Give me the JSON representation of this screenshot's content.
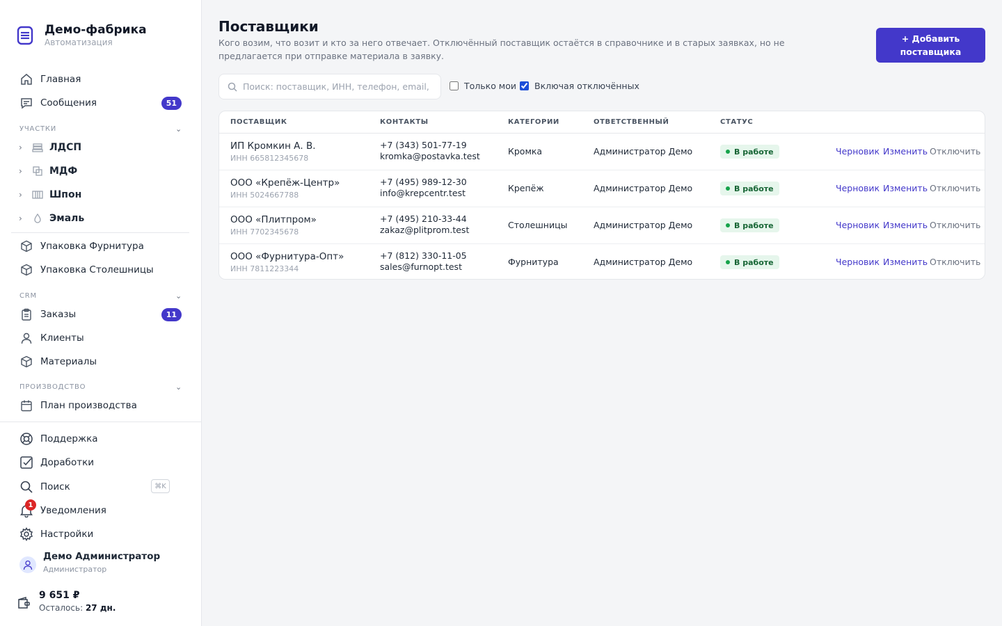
{
  "brand": {
    "name": "Демо-фабрика",
    "subtitle": "Автоматизация"
  },
  "nav": {
    "home": "Главная",
    "messages": {
      "label": "Сообщения",
      "badge": "51"
    },
    "sections": {
      "sites": "Участки",
      "crm": "CRM",
      "production": "Производство"
    },
    "sites": [
      {
        "label": "ЛДСП"
      },
      {
        "label": "МДФ"
      },
      {
        "label": "Шпон"
      },
      {
        "label": "Эмаль"
      }
    ],
    "packing_hardware": "Упаковка Фурнитура",
    "packing_tops": "Упаковка Столешницы",
    "orders": {
      "label": "Заказы",
      "badge": "11"
    },
    "clients": "Клиенты",
    "materials": "Материалы",
    "production_plan": "План производства",
    "support": "Поддержка",
    "improvements": "Доработки",
    "search": {
      "label": "Поиск",
      "shortcut": "⌘K"
    },
    "notifications": {
      "label": "Уведомления",
      "count": "1"
    },
    "settings": "Настройки"
  },
  "user": {
    "name": "Демо Администратор",
    "role": "Администратор"
  },
  "balance": {
    "amount": "9 651 ₽",
    "left_label": "Осталось:",
    "left_value": "27 дн."
  },
  "page": {
    "title": "Поставщики",
    "description": "Кого возим, что возит и кто за него отвечает. Отключённый поставщик остаётся в справочнике и в старых заявках, но не предлагается при отправке материала в заявку.",
    "add_button": "+ Добавить поставщика"
  },
  "filters": {
    "search_placeholder": "Поиск: поставщик, ИНН, телефон, email, категория",
    "search_value": "",
    "only_mine": {
      "label": "Только мои",
      "checked": false
    },
    "include_disabled": {
      "label": "Включая отключённых",
      "checked": true
    }
  },
  "table": {
    "columns": [
      "Поставщик",
      "Контакты",
      "Категории",
      "Ответственный",
      "Статус"
    ],
    "actions": {
      "draft": "Черновик",
      "edit": "Изменить",
      "disable": "Отключить"
    },
    "rows": [
      {
        "name": "ИП Кромкин А. В.",
        "inn": "ИНН 665812345678",
        "phone": "+7 (343) 501-77-19",
        "email": "kromka@postavka.test",
        "category": "Кромка",
        "responsible": "Администратор Демо",
        "status": "В работе"
      },
      {
        "name": "ООО «Крепёж-Центр»",
        "inn": "ИНН 5024667788",
        "phone": "+7 (495) 989-12-30",
        "email": "info@krepcentr.test",
        "category": "Крепёж",
        "responsible": "Администратор Демо",
        "status": "В работе"
      },
      {
        "name": "ООО «Плитпром»",
        "inn": "ИНН 7702345678",
        "phone": "+7 (495) 210-33-44",
        "email": "zakaz@plitprom.test",
        "category": "Столешницы",
        "responsible": "Администратор Демо",
        "status": "В работе"
      },
      {
        "name": "ООО «Фурнитура-Опт»",
        "inn": "ИНН 7811223344",
        "phone": "+7 (812) 330-11-05",
        "email": "sales@furnopt.test",
        "category": "Фурнитура",
        "responsible": "Администратор Демо",
        "status": "В работе"
      }
    ]
  },
  "colors": {
    "accent": "#4338ca",
    "status_bg": "#e6f6ec",
    "status_text": "#166534",
    "danger": "#dc2626"
  }
}
